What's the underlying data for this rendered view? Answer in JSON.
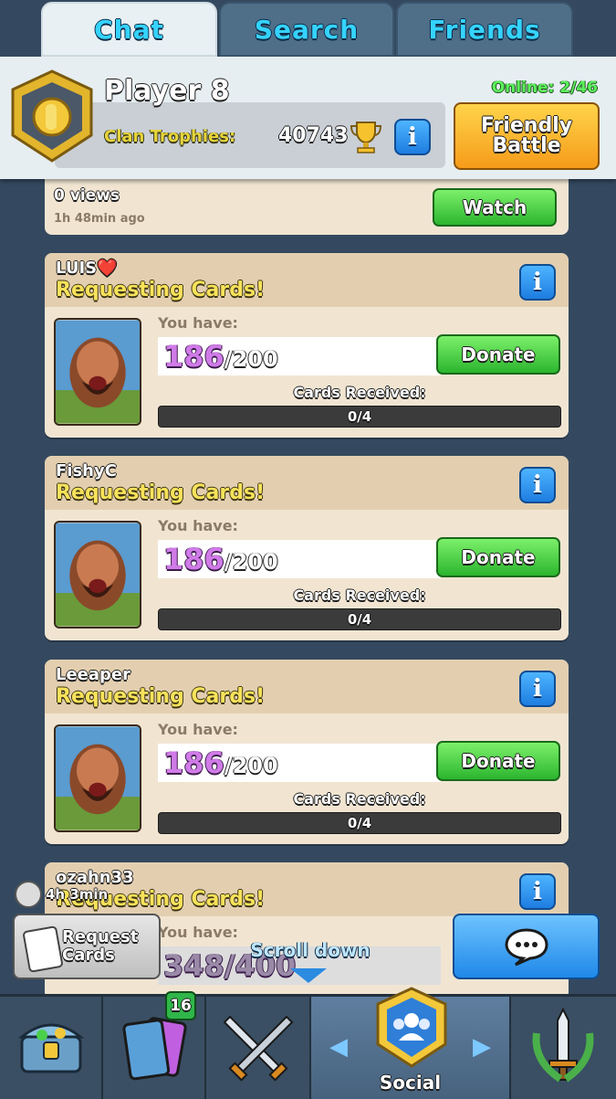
{
  "tabs": [
    {
      "label": "Chat"
    },
    {
      "label": "Search"
    },
    {
      "label": "Friends"
    }
  ],
  "player": {
    "name": "Player 8",
    "clan_trophies_label": "Clan Trophies:",
    "clan_trophies_value": "40743",
    "online": "Online: 2/46",
    "friendly_battle_label": "Friendly Battle"
  },
  "replay": {
    "views": "0 views",
    "ago": "1h 48min ago",
    "watch_label": "Watch"
  },
  "requests": [
    {
      "user": "LUIS❤️",
      "status": "Requesting Cards!",
      "you_have_label": "You have:",
      "have": "186",
      "total": "/200",
      "donate_label": "Donate",
      "received_label": "Cards Received:",
      "received": "0/4"
    },
    {
      "user": "FishyC",
      "status": "Requesting Cards!",
      "you_have_label": "You have:",
      "have": "186",
      "total": "/200",
      "donate_label": "Donate",
      "received_label": "Cards Received:",
      "received": "0/4"
    },
    {
      "user": "Leeaper",
      "status": "Requesting Cards!",
      "you_have_label": "You have:",
      "have": "186",
      "total": "/200",
      "donate_label": "Donate",
      "received_label": "Cards Received:",
      "received": "0/4"
    }
  ],
  "partial_request": {
    "user": "ozahn33",
    "status": "Requesting Cards!",
    "you_have_label": "You have:",
    "have": "348/400"
  },
  "timer": "4h 3min",
  "request_cards_label": "Request Cards",
  "scroll_hint": "Scroll down",
  "nav": {
    "cards_badge": "16",
    "social_label": "Social"
  },
  "colors": {
    "background": "#34495f",
    "tab_active": "#e8f0f3",
    "donate_green": "#2cb52f",
    "info_blue": "#1e7de0"
  }
}
